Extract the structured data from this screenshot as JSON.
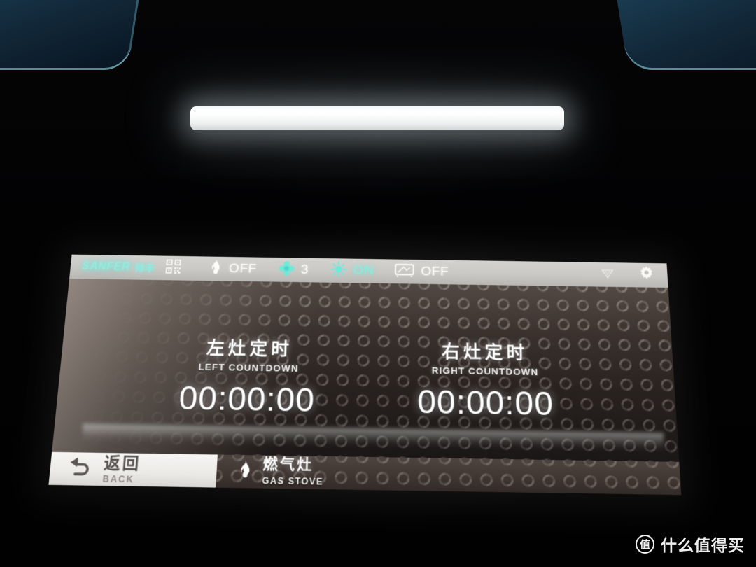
{
  "brand": {
    "logo_text": "SANFER",
    "logo_cn": "帅丰",
    "qr_icon": "qr-code-icon"
  },
  "toolbar": {
    "items": [
      {
        "icon": "flame-icon",
        "icon_state": "off",
        "value": "OFF",
        "value_state": "off"
      },
      {
        "icon": "fan-icon",
        "icon_state": "on",
        "value": "3",
        "value_state": "off"
      },
      {
        "icon": "light-icon",
        "icon_state": "on",
        "value": "ON",
        "value_state": "on"
      },
      {
        "icon": "steamer-icon",
        "icon_state": "off",
        "value": "OFF",
        "value_state": "off"
      }
    ],
    "right_icons": [
      {
        "name": "water-drop-icon"
      },
      {
        "name": "gear-icon"
      }
    ]
  },
  "display": {
    "timers": [
      {
        "title_cn": "左灶定时",
        "title_en": "LEFT COUNTDOWN",
        "value": "00:00:00"
      },
      {
        "title_cn": "右灶定时",
        "title_en": "RIGHT COUNTDOWN",
        "value": "00:00:00"
      }
    ]
  },
  "bottom_bar": {
    "back": {
      "icon": "back-arrow-icon",
      "label_cn": "返回",
      "label_en": "BACK"
    },
    "stove_tab": {
      "icon": "flame-icon",
      "label_cn": "燃气灶",
      "label_en": "GAS STOVE",
      "active": true
    }
  },
  "watermark": {
    "badge": "值",
    "text": "什么值得买"
  },
  "colors": {
    "accent_cyan": "#6fe9da",
    "toolbar_bg": "#c9c8c4",
    "panel_bg": "#3a312d",
    "back_btn_bg": "#eceae7",
    "text_white": "#ffffff"
  }
}
